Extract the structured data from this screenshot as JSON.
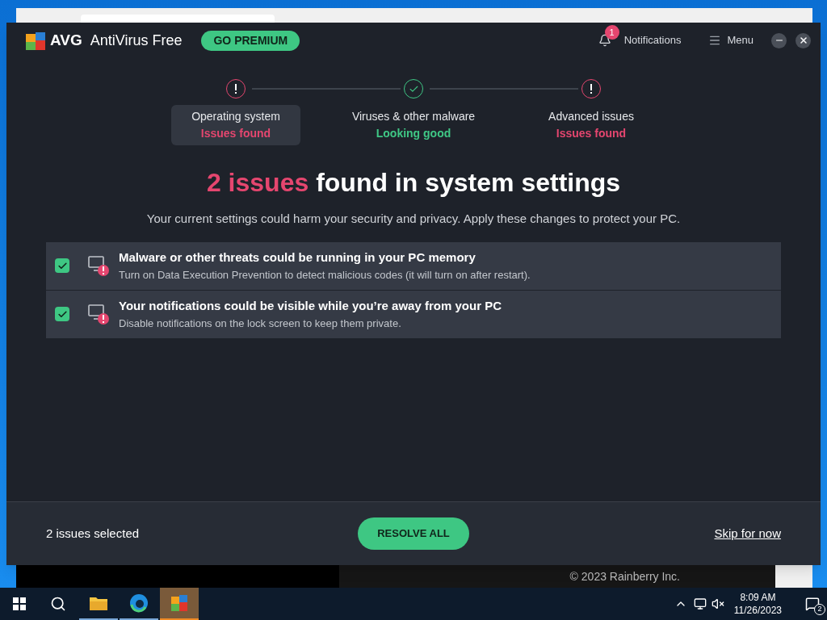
{
  "app": {
    "brand": "AVG",
    "product": "AntiVirus Free",
    "premium_button": "GO PREMIUM",
    "notifications": {
      "label": "Notifications",
      "count": "1"
    },
    "menu": "Menu"
  },
  "steps": [
    {
      "title": "Operating system",
      "status": "Issues found",
      "kind": "issue",
      "selected": true
    },
    {
      "title": "Viruses & other malware",
      "status": "Looking good",
      "kind": "ok",
      "selected": false
    },
    {
      "title": "Advanced issues",
      "status": "Issues found",
      "kind": "issue",
      "selected": false
    }
  ],
  "headline": {
    "count": "2 issues",
    "rest": "found in system settings"
  },
  "subtitle": "Your current settings could harm your security and privacy. Apply these changes to protect your PC.",
  "issues": [
    {
      "title": "Malware or other threats could be running in your PC memory",
      "description": "Turn on Data Execution Prevention to detect malicious codes (it will turn on after restart).",
      "checked": true
    },
    {
      "title": "Your notifications could be visible while you’re away from your PC",
      "description": "Disable notifications on the lock screen to keep them private.",
      "checked": true
    }
  ],
  "footer": {
    "selected_count": "2 issues selected",
    "resolve_button": "RESOLVE ALL",
    "skip_link": "Skip for now"
  },
  "background_window": {
    "copyright": "© 2023 Rainberry Inc."
  },
  "taskbar": {
    "apps": [
      {
        "kind": "explorer",
        "selected": false
      },
      {
        "kind": "browser",
        "selected": false
      },
      {
        "kind": "avg",
        "selected": true
      }
    ],
    "time": "8:09 AM",
    "date": "11/26/2023",
    "notification_count": "2"
  }
}
